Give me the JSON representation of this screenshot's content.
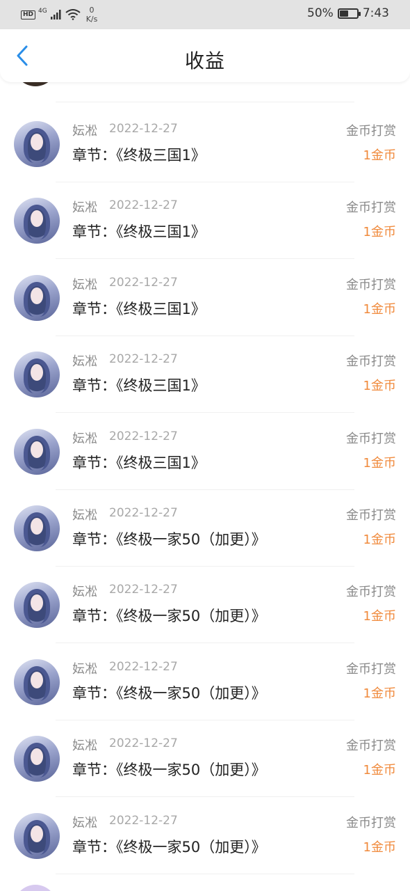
{
  "status_bar": {
    "hd": "HD",
    "network": "4G",
    "speed_value": "0",
    "speed_unit": "K/s",
    "battery": "50%",
    "battery_level": 0.5,
    "time": "7:43"
  },
  "header": {
    "title": "收益"
  },
  "colors": {
    "accent_blue": "#2a8ee8",
    "amount_orange": "#f08a3c"
  },
  "records": [
    {
      "name": "妘凇",
      "date": "2022-12-27",
      "type": "金币打赏",
      "chapter": "章节：《终极三国1》",
      "amount": "1金币"
    },
    {
      "name": "妘凇",
      "date": "2022-12-27",
      "type": "金币打赏",
      "chapter": "章节：《终极三国1》",
      "amount": "1金币"
    },
    {
      "name": "妘凇",
      "date": "2022-12-27",
      "type": "金币打赏",
      "chapter": "章节：《终极三国1》",
      "amount": "1金币"
    },
    {
      "name": "妘凇",
      "date": "2022-12-27",
      "type": "金币打赏",
      "chapter": "章节：《终极三国1》",
      "amount": "1金币"
    },
    {
      "name": "妘凇",
      "date": "2022-12-27",
      "type": "金币打赏",
      "chapter": "章节：《终极三国1》",
      "amount": "1金币"
    },
    {
      "name": "妘凇",
      "date": "2022-12-27",
      "type": "金币打赏",
      "chapter": "章节：《终极一家50（加更）》",
      "amount": "1金币"
    },
    {
      "name": "妘凇",
      "date": "2022-12-27",
      "type": "金币打赏",
      "chapter": "章节：《终极一家50（加更）》",
      "amount": "1金币"
    },
    {
      "name": "妘凇",
      "date": "2022-12-27",
      "type": "金币打赏",
      "chapter": "章节：《终极一家50（加更）》",
      "amount": "1金币"
    },
    {
      "name": "妘凇",
      "date": "2022-12-27",
      "type": "金币打赏",
      "chapter": "章节：《终极一家50（加更）》",
      "amount": "1金币"
    },
    {
      "name": "妘凇",
      "date": "2022-12-27",
      "type": "金币打赏",
      "chapter": "章节：《终极一家50（加更）》",
      "amount": "1金币"
    }
  ]
}
